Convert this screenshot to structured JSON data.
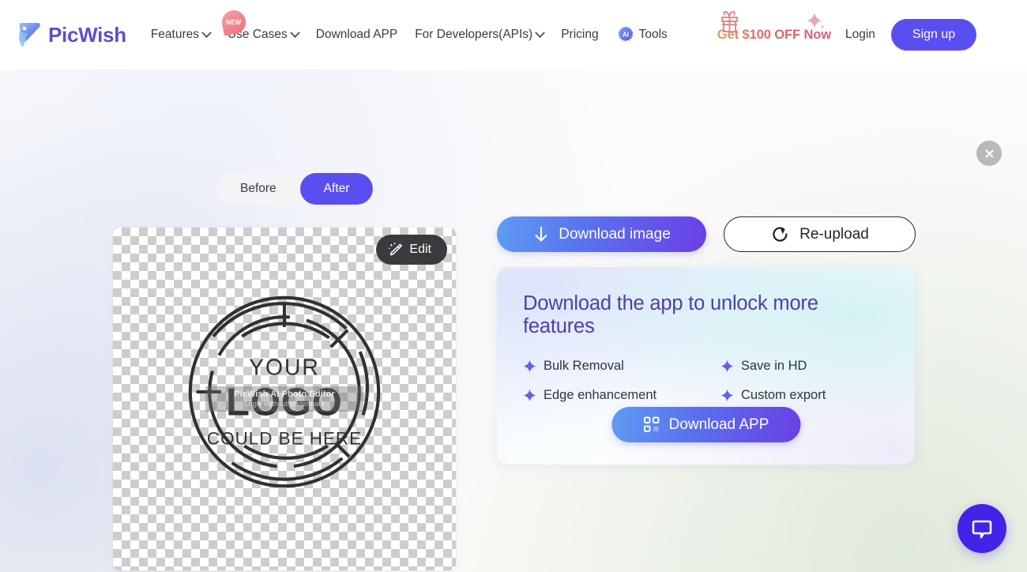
{
  "brand": {
    "name": "PicWish",
    "logo_icon": "picwish-bird-logo"
  },
  "nav": {
    "items": [
      {
        "label": "Features",
        "has_caret": true,
        "badge": null
      },
      {
        "label": "Use Cases",
        "has_caret": true,
        "badge": "NEW"
      },
      {
        "label": "Download APP",
        "has_caret": false,
        "badge": null
      },
      {
        "label": "For Developers(APIs)",
        "has_caret": true,
        "badge": null
      },
      {
        "label": "Pricing",
        "has_caret": false,
        "badge": null
      }
    ],
    "ai_tools": {
      "chip": "AI",
      "label": "Tools"
    },
    "promo": {
      "label": "Get $100 OFF Now",
      "gift_icon": "gift-icon",
      "star_icon": "sparkle-star-icon"
    },
    "login": "Login",
    "signup": "Sign up"
  },
  "toggle": {
    "before": "Before",
    "after": "After",
    "selected": "After"
  },
  "preview": {
    "edit_label": "Edit",
    "edit_icon": "magic-pencil-icon",
    "artwork": {
      "line1": "YOUR",
      "line2": "LOGO",
      "line3": "COULD BE HERE"
    },
    "watermark": {
      "main": "PicWish AI Photo Editor",
      "sub": "Login Without Watermark"
    }
  },
  "actions": {
    "download_image": {
      "label": "Download image",
      "icon": "download-arrow-icon"
    },
    "re_upload": {
      "label": "Re-upload",
      "icon": "refresh-icon"
    }
  },
  "app_card": {
    "title": "Download the app to unlock more features",
    "features": [
      "Bulk Removal",
      "Save in HD",
      "Edge enhancement",
      "Custom export"
    ],
    "cta": {
      "label": "Download APP",
      "icon": "qr-grid-icon"
    }
  },
  "close_button": {
    "icon": "close-icon"
  },
  "chat_widget": {
    "icon": "chat-bubble-icon"
  },
  "colors": {
    "accent_purple": "#5a4ef0",
    "card_title": "#4b41a6",
    "gradient_blue": "#5e9cf3",
    "gradient_purple": "#6a3fe6",
    "chat_purple": "#4423e8",
    "promo_pink": "#d95f68"
  }
}
